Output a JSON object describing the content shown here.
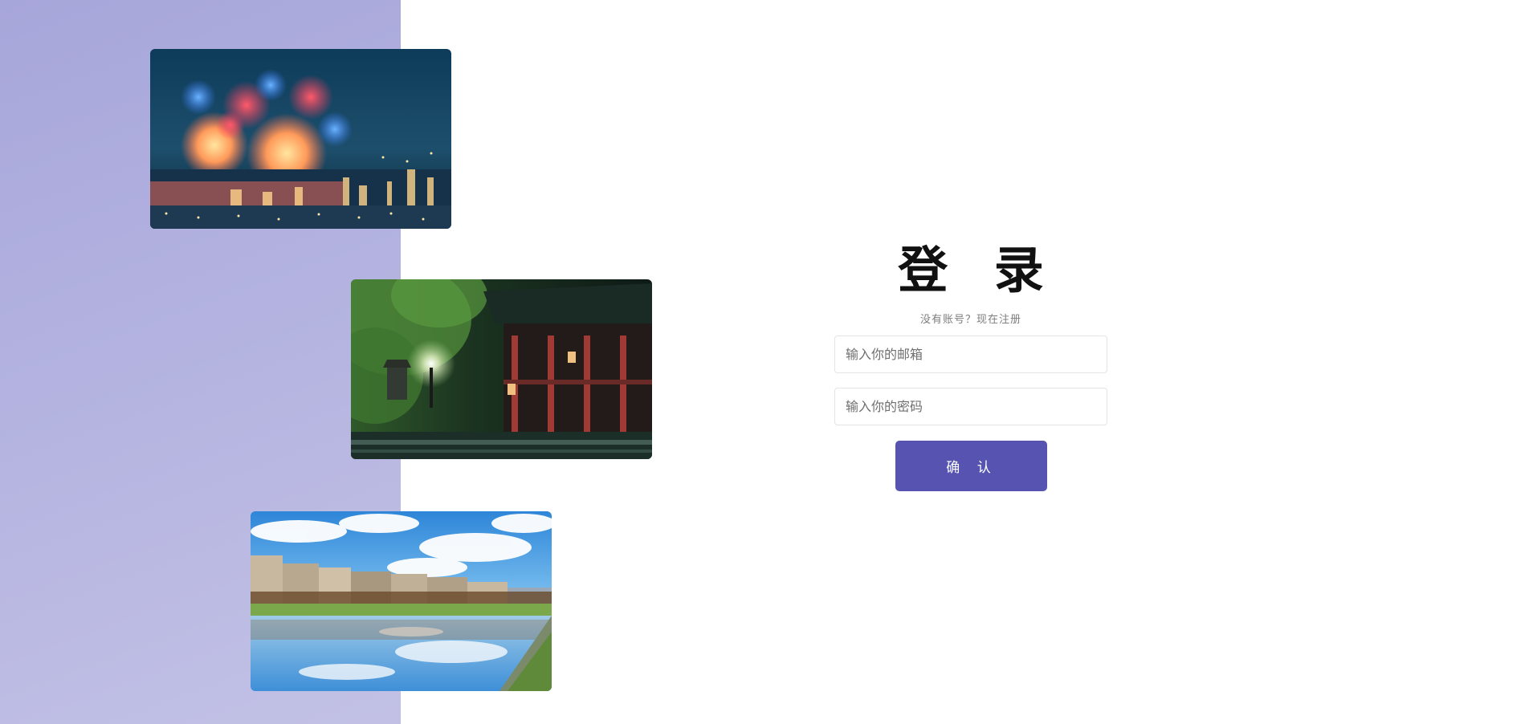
{
  "login": {
    "title": "登 录",
    "register_hint": "没有账号？现在注册",
    "email_placeholder": "输入你的邮箱",
    "password_placeholder": "输入你的密码",
    "confirm_label": "确 认"
  },
  "colors": {
    "left_panel": "#aeacdd",
    "button": "#5654b0"
  }
}
